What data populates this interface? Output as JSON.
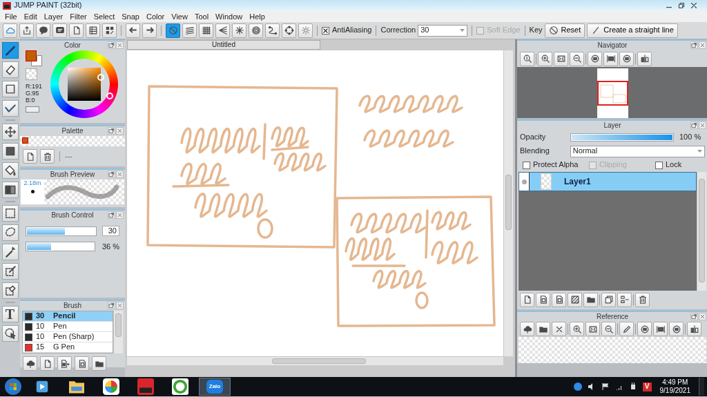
{
  "window": {
    "title": "JUMP PAINT (32bit)"
  },
  "menu": [
    "File",
    "Edit",
    "Layer",
    "Filter",
    "Select",
    "Snap",
    "Color",
    "View",
    "Tool",
    "Window",
    "Help"
  ],
  "snap_modes": [
    {
      "selected": true
    },
    {
      "selected": false
    },
    {
      "selected": false
    },
    {
      "selected": false
    },
    {
      "selected": false
    },
    {
      "selected": false
    },
    {
      "selected": false
    },
    {
      "selected": false
    },
    {
      "selected": false
    }
  ],
  "antialiasing": {
    "label": "AntiAliasing",
    "checked": true
  },
  "correction": {
    "label": "Correction",
    "value": "30"
  },
  "soft_edge": {
    "label": "Soft Edge",
    "checked": false,
    "disabled": true
  },
  "key": {
    "label": "Key",
    "buttons": [
      "Reset",
      "Create a straight line"
    ]
  },
  "tools": [
    {
      "selected": true
    },
    {
      "selected": false
    },
    {
      "selected": false
    },
    {
      "selected": false
    },
    {
      "selected": false
    },
    {
      "selected": false
    },
    {
      "selected": false
    },
    {
      "selected": false
    },
    {
      "selected": false
    },
    {
      "selected": false
    },
    {
      "selected": false
    },
    {
      "selected": false
    },
    {
      "selected": false
    },
    {
      "selected": false,
      "glyph": "T"
    },
    {
      "selected": false
    }
  ],
  "color_panel": {
    "title": "Color",
    "foreground": {
      "color": "#bf5f00"
    },
    "readings": [
      "R:191",
      "G:95",
      "B:0"
    ]
  },
  "palette": {
    "title": "Palette",
    "swatches": [
      {
        "color": "#c85a10"
      }
    ],
    "separator_text": "---"
  },
  "brush_preview": {
    "title": "Brush Preview",
    "size": "2.18m"
  },
  "brush_control": {
    "title": "Brush Control",
    "sliders": [
      {
        "kind": "field",
        "level": 0.55,
        "reading": "30"
      },
      {
        "kind": "text",
        "level": 0.36,
        "reading": "36 %"
      }
    ]
  },
  "brush": {
    "title": "Brush",
    "items": [
      {
        "size": "30",
        "name": "Pencil",
        "color": "#2a2a2a",
        "selected": true
      },
      {
        "size": "10",
        "name": "Pen",
        "color": "#2a2a2a",
        "selected": false
      },
      {
        "size": "10",
        "name": "Pen (Sharp)",
        "color": "#2a2a2a",
        "selected": false
      },
      {
        "size": "15",
        "name": "G Pen",
        "color": "#e53030",
        "selected": false
      }
    ]
  },
  "document": {
    "tab": "Untitled"
  },
  "navigator": {
    "title": "Navigator"
  },
  "layer": {
    "title": "Layer",
    "opacity": {
      "label": "Opacity",
      "level": 1,
      "reading": "100 %"
    },
    "blending": {
      "label": "Blending",
      "value": "Normal"
    },
    "options": [
      {
        "label": "Protect Alpha",
        "checked": false,
        "disabled": false
      },
      {
        "label": "Clipping",
        "checked": false,
        "disabled": true
      },
      {
        "label": "Lock",
        "checked": false,
        "disabled": false
      }
    ],
    "layers": [
      {
        "name": "Layer1",
        "selected": true
      }
    ]
  },
  "reference": {
    "title": "Reference"
  },
  "taskbar": {
    "apps": [
      {
        "kind": "player"
      },
      {
        "kind": "folder"
      },
      {
        "kind": "colorball"
      },
      {
        "kind": "paint"
      },
      {
        "kind": "greenapp"
      },
      {
        "kind": "zalo",
        "label": "Zalo"
      }
    ],
    "tray_glyph": "V",
    "time": "4:49 PM",
    "date": "9/19/2021"
  }
}
